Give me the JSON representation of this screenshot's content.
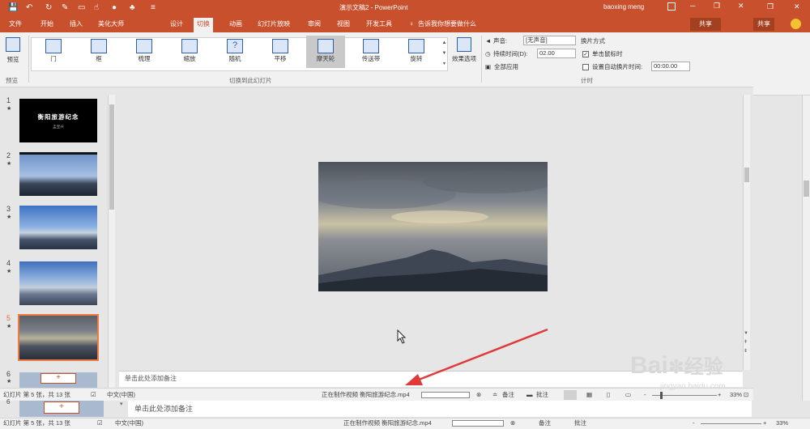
{
  "window": {
    "title": "演示文稿2 - PowerPoint",
    "user": "baoxing meng",
    "share": "共享",
    "min": "─",
    "restore": "❐",
    "close": "✕"
  },
  "tabs": [
    "文件",
    "开始",
    "插入",
    "美化大师",
    "设计",
    "切换",
    "动画",
    "幻灯片放映",
    "审阅",
    "视图",
    "开发工具"
  ],
  "tellme": "告诉我你想要做什么",
  "ribbon": {
    "preview_label": "预览",
    "preview_group": "预览",
    "transitions": [
      "门",
      "框",
      "梳理",
      "缩放",
      "随机",
      "平移",
      "摩天轮",
      "传送带",
      "旋转"
    ],
    "selected_transition": "摩天轮",
    "effect_options": "效果选项",
    "group_label": "切换到此幻灯片",
    "sound_label": "声音:",
    "sound_value": "[无声音]",
    "duration_label": "持续时间(D):",
    "duration_value": "02.00",
    "apply_all": "全部应用",
    "advance_label": "换片方式",
    "on_click": "单击鼠标时",
    "after_label": "设置自动换片时间:",
    "after_value": "00:00.00",
    "timing_group": "计时"
  },
  "thumbnails": {
    "slide1_title": "衡阳旅游纪念",
    "slide1_sub": "孟宝兴",
    "numbers": [
      "1",
      "2",
      "3",
      "4",
      "5",
      "6"
    ],
    "star": "★",
    "add": "+"
  },
  "notes_placeholder": "单击此处添加备注",
  "status": {
    "slide_info": "幻灯片 第 5 张，共 13 张",
    "language": "中文(中国)",
    "video_status": "正在制作视频 衡阳旅游纪念.mp4",
    "notes": "备注",
    "comments": "批注",
    "zoom": "33%",
    "minus": "-",
    "plus": "+"
  },
  "watermark": {
    "brand": "Bai",
    "brand2": "经验",
    "url": "jingyan.baidu.com"
  },
  "colors": {
    "accent": "#c8502d",
    "arrow": "#e03a3a",
    "selected_slide": "#f07a46"
  }
}
